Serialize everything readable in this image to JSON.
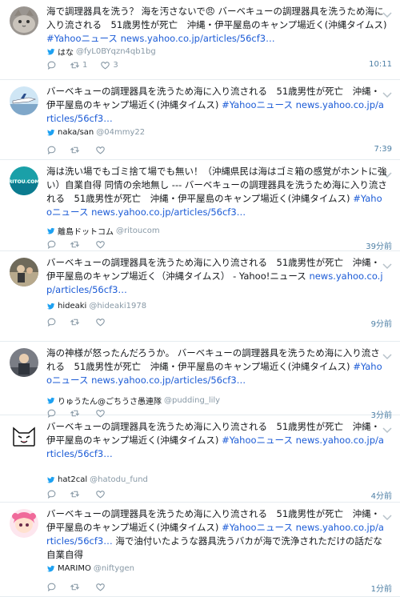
{
  "tweets": [
    {
      "text_parts": [
        {
          "t": "海で調理器具を洗う？ 海を汚さないで😠 バーベキューの調理器具を洗うため海に入り流される　51歳男性が死亡　沖縄・伊平屋島のキャンプ場近く(沖縄タイムス) "
        },
        {
          "t": "#Yahooニュース news.yahoo.co.jp/articles/56cf3…",
          "link": true
        }
      ],
      "name": "はな",
      "handle": "@fyL0BYqzn4qb1bg",
      "retweets": "1",
      "likes": "3",
      "time": "10:11",
      "avatar": "cat"
    },
    {
      "text_parts": [
        {
          "t": "バーベキューの調理器具を洗うため海に入り流される　51歳男性が死亡　沖縄・伊平屋島のキャンプ場近く(沖縄タイムス) "
        },
        {
          "t": "#Yahooニュース news.yahoo.co.jp/articles/56cf3…",
          "link": true
        }
      ],
      "name": "naka/san",
      "handle": "@04mmy22",
      "retweets": "",
      "likes": "",
      "time": "7:39",
      "avatar": "plane"
    },
    {
      "text_parts": [
        {
          "t": "海は洗い場でもゴミ捨て場でも無い！（沖縄県民は海はゴミ箱の感覚がホントに強い）自業自得 同情の余地無し --- バーベキューの調理器具を洗うため海に入り流される　51歳男性が死亡　沖縄・伊平屋島のキャンプ場近く(沖縄タイムス) "
        },
        {
          "t": "#Yahooニュース news.yahoo.co.jp/articles/56cf3…",
          "link": true
        }
      ],
      "name": "離島ドットコム",
      "handle": "@ritoucom",
      "retweets": "",
      "likes": "",
      "time": "39分前",
      "avatar": "ritou",
      "avatar_text": "RITOU.COM"
    },
    {
      "text_parts": [
        {
          "t": "バーベキューの調理器具を洗うため海に入り流される　51歳男性が死亡　沖縄・伊平屋島のキャンプ場近く（沖縄タイムス） - Yahoo!ニュース "
        },
        {
          "t": "news.yahoo.co.jp/articles/56cf3…",
          "link": true
        }
      ],
      "name": "hideaki",
      "handle": "@hideaki1978",
      "retweets": "",
      "likes": "",
      "time": "9分前",
      "avatar": "photo"
    },
    {
      "text_parts": [
        {
          "t": "海の神様が怒ったんだろうか。 バーベキューの調理器具を洗うため海に入り流される　51歳男性が死亡　沖縄・伊平屋島のキャンプ場近く(沖縄タイムス) "
        },
        {
          "t": "#Yahooニュース news.yahoo.co.jp/articles/56cf3…",
          "link": true
        }
      ],
      "name": "りゅうたん@ごちうさ愚連隊",
      "handle": "@pudding_lily",
      "retweets": "",
      "likes": "",
      "time": "3分前",
      "avatar": "person"
    },
    {
      "text_parts": [
        {
          "t": "バーベキューの調理器具を洗うため海に入り流される　51歳男性が死亡　沖縄・伊平屋島のキャンプ場近く(沖縄タイムス) "
        },
        {
          "t": "#Yahooニュース news.yahoo.co.jp/articles/56cf3…",
          "link": true
        }
      ],
      "name": "hat2cal",
      "handle": "@hatodu_fund",
      "retweets": "",
      "likes": "",
      "time": "4分前",
      "avatar": "whitecat"
    },
    {
      "text_parts": [
        {
          "t": "バーベキューの調理器具を洗うため海に入り流される　51歳男性が死亡　沖縄・伊平屋島のキャンプ場近く(沖縄タイムス) "
        },
        {
          "t": "#Yahooニュース news.yahoo.co.jp/articles/56cf3…",
          "link": true
        },
        {
          "t": " 海で油付いたような器具洗うバカが海で洗浄されただけの話だな 自業自得"
        }
      ],
      "name": "MARIMO",
      "handle": "@niftygen",
      "retweets": "",
      "likes": "",
      "time": "1分前",
      "avatar": "anime"
    }
  ],
  "colors": {
    "link": "#1b5bd6",
    "muted": "#8899a6",
    "bird": "#1da1f2",
    "divider": "#e6ecf0"
  },
  "icons": {
    "reply": "reply-icon",
    "retweet": "retweet-icon",
    "like": "like-icon",
    "bird": "twitter-bird-icon",
    "caret": "chevron-down-icon"
  }
}
